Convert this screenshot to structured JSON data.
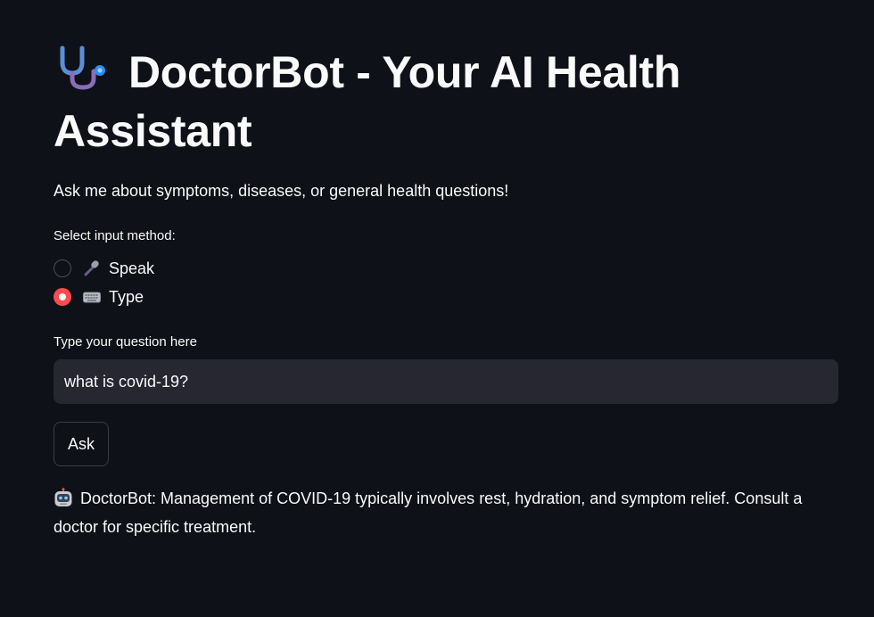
{
  "header": {
    "icon": "stethoscope-icon",
    "title": "DoctorBot - Your AI Health Assistant"
  },
  "intro": {
    "subtitle": "Ask me about symptoms, diseases, or general health questions!"
  },
  "input_method": {
    "label": "Select input method:",
    "options": [
      {
        "icon": "microphone-icon",
        "label": "Speak",
        "selected": false
      },
      {
        "icon": "keyboard-icon",
        "label": "Type",
        "selected": true
      }
    ]
  },
  "question": {
    "label": "Type your question here",
    "value": "what is covid-19?"
  },
  "ask_button": {
    "label": "Ask"
  },
  "response": {
    "icon": "robot-icon",
    "text": "DoctorBot: Management of COVID-19 typically involves rest, hydration, and symptom relief. Consult a doctor for specific treatment."
  },
  "colors": {
    "background": "#0e1117",
    "input_background": "#262730",
    "accent": "#ff4b4b",
    "text": "#fafafa"
  }
}
